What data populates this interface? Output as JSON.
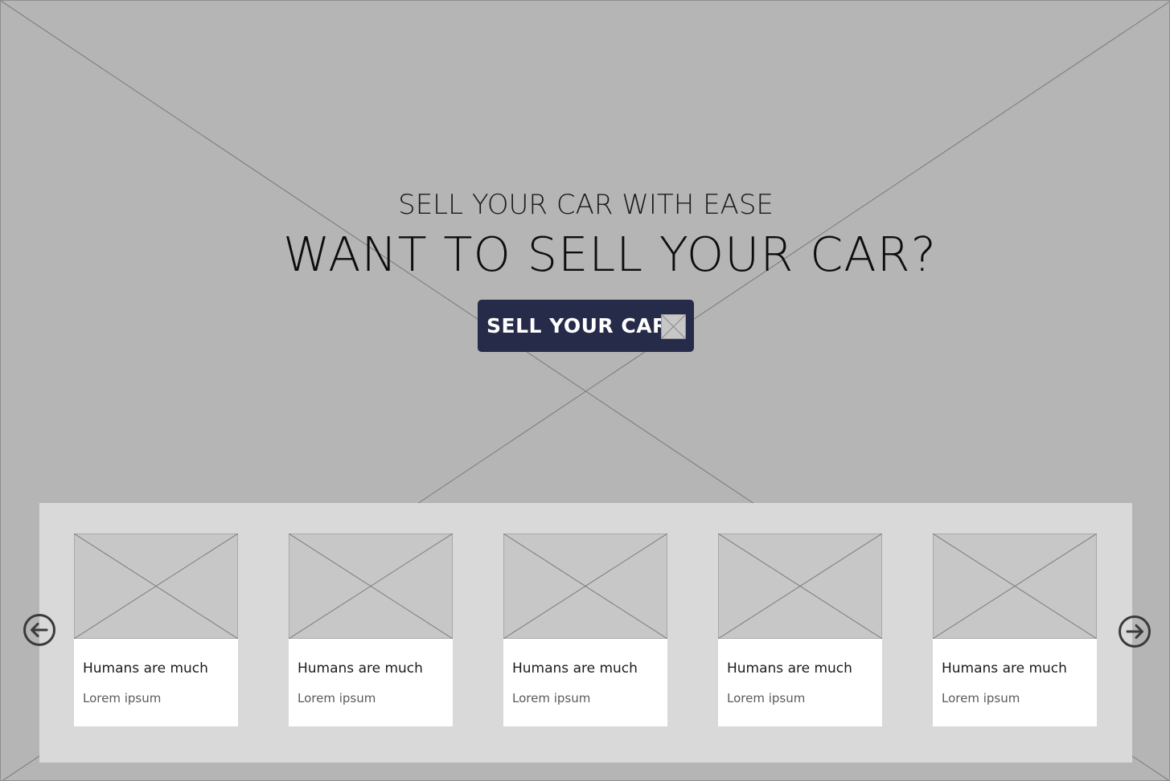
{
  "hero": {
    "eyebrow": "SELL YOUR CAR WITH EASE",
    "headline": "WANT TO SELL YOUR CAR?",
    "cta_label": "SELL YOUR CAR",
    "cta_icon": "image-placeholder-icon",
    "background": "image-placeholder"
  },
  "carousel": {
    "prev_icon": "arrow-left-circle-icon",
    "next_icon": "arrow-right-circle-icon",
    "cards": [
      {
        "title": "Humans are much",
        "text": "Lorem ipsum"
      },
      {
        "title": "Humans are much",
        "text": "Lorem ipsum"
      },
      {
        "title": "Humans are much",
        "text": "Lorem ipsum"
      },
      {
        "title": "Humans are much",
        "text": "Lorem ipsum"
      },
      {
        "title": "Humans are much",
        "text": "Lorem ipsum"
      }
    ]
  },
  "colors": {
    "hero_background": "#b5b5b5",
    "button_background": "#272b4a",
    "carousel_background": "#d9d9d9",
    "card_background": "#ffffff",
    "placeholder_fill": "#c7c7c7"
  }
}
